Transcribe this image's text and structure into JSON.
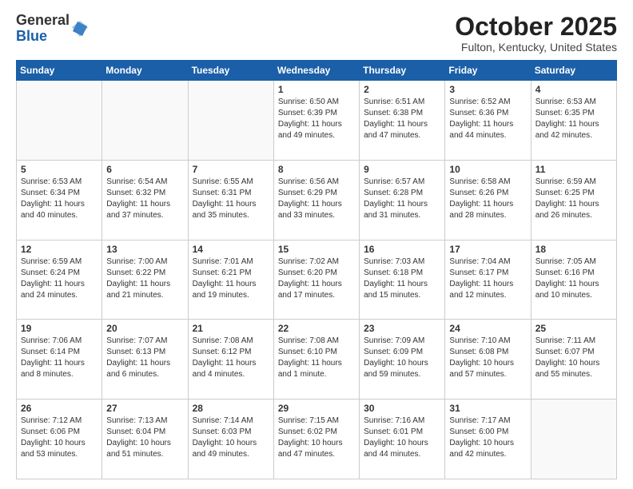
{
  "logo": {
    "general": "General",
    "blue": "Blue"
  },
  "header": {
    "month": "October 2025",
    "location": "Fulton, Kentucky, United States"
  },
  "weekdays": [
    "Sunday",
    "Monday",
    "Tuesday",
    "Wednesday",
    "Thursday",
    "Friday",
    "Saturday"
  ],
  "weeks": [
    [
      {
        "day": "",
        "info": ""
      },
      {
        "day": "",
        "info": ""
      },
      {
        "day": "",
        "info": ""
      },
      {
        "day": "1",
        "info": "Sunrise: 6:50 AM\nSunset: 6:39 PM\nDaylight: 11 hours\nand 49 minutes."
      },
      {
        "day": "2",
        "info": "Sunrise: 6:51 AM\nSunset: 6:38 PM\nDaylight: 11 hours\nand 47 minutes."
      },
      {
        "day": "3",
        "info": "Sunrise: 6:52 AM\nSunset: 6:36 PM\nDaylight: 11 hours\nand 44 minutes."
      },
      {
        "day": "4",
        "info": "Sunrise: 6:53 AM\nSunset: 6:35 PM\nDaylight: 11 hours\nand 42 minutes."
      }
    ],
    [
      {
        "day": "5",
        "info": "Sunrise: 6:53 AM\nSunset: 6:34 PM\nDaylight: 11 hours\nand 40 minutes."
      },
      {
        "day": "6",
        "info": "Sunrise: 6:54 AM\nSunset: 6:32 PM\nDaylight: 11 hours\nand 37 minutes."
      },
      {
        "day": "7",
        "info": "Sunrise: 6:55 AM\nSunset: 6:31 PM\nDaylight: 11 hours\nand 35 minutes."
      },
      {
        "day": "8",
        "info": "Sunrise: 6:56 AM\nSunset: 6:29 PM\nDaylight: 11 hours\nand 33 minutes."
      },
      {
        "day": "9",
        "info": "Sunrise: 6:57 AM\nSunset: 6:28 PM\nDaylight: 11 hours\nand 31 minutes."
      },
      {
        "day": "10",
        "info": "Sunrise: 6:58 AM\nSunset: 6:26 PM\nDaylight: 11 hours\nand 28 minutes."
      },
      {
        "day": "11",
        "info": "Sunrise: 6:59 AM\nSunset: 6:25 PM\nDaylight: 11 hours\nand 26 minutes."
      }
    ],
    [
      {
        "day": "12",
        "info": "Sunrise: 6:59 AM\nSunset: 6:24 PM\nDaylight: 11 hours\nand 24 minutes."
      },
      {
        "day": "13",
        "info": "Sunrise: 7:00 AM\nSunset: 6:22 PM\nDaylight: 11 hours\nand 21 minutes."
      },
      {
        "day": "14",
        "info": "Sunrise: 7:01 AM\nSunset: 6:21 PM\nDaylight: 11 hours\nand 19 minutes."
      },
      {
        "day": "15",
        "info": "Sunrise: 7:02 AM\nSunset: 6:20 PM\nDaylight: 11 hours\nand 17 minutes."
      },
      {
        "day": "16",
        "info": "Sunrise: 7:03 AM\nSunset: 6:18 PM\nDaylight: 11 hours\nand 15 minutes."
      },
      {
        "day": "17",
        "info": "Sunrise: 7:04 AM\nSunset: 6:17 PM\nDaylight: 11 hours\nand 12 minutes."
      },
      {
        "day": "18",
        "info": "Sunrise: 7:05 AM\nSunset: 6:16 PM\nDaylight: 11 hours\nand 10 minutes."
      }
    ],
    [
      {
        "day": "19",
        "info": "Sunrise: 7:06 AM\nSunset: 6:14 PM\nDaylight: 11 hours\nand 8 minutes."
      },
      {
        "day": "20",
        "info": "Sunrise: 7:07 AM\nSunset: 6:13 PM\nDaylight: 11 hours\nand 6 minutes."
      },
      {
        "day": "21",
        "info": "Sunrise: 7:08 AM\nSunset: 6:12 PM\nDaylight: 11 hours\nand 4 minutes."
      },
      {
        "day": "22",
        "info": "Sunrise: 7:08 AM\nSunset: 6:10 PM\nDaylight: 11 hours\nand 1 minute."
      },
      {
        "day": "23",
        "info": "Sunrise: 7:09 AM\nSunset: 6:09 PM\nDaylight: 10 hours\nand 59 minutes."
      },
      {
        "day": "24",
        "info": "Sunrise: 7:10 AM\nSunset: 6:08 PM\nDaylight: 10 hours\nand 57 minutes."
      },
      {
        "day": "25",
        "info": "Sunrise: 7:11 AM\nSunset: 6:07 PM\nDaylight: 10 hours\nand 55 minutes."
      }
    ],
    [
      {
        "day": "26",
        "info": "Sunrise: 7:12 AM\nSunset: 6:06 PM\nDaylight: 10 hours\nand 53 minutes."
      },
      {
        "day": "27",
        "info": "Sunrise: 7:13 AM\nSunset: 6:04 PM\nDaylight: 10 hours\nand 51 minutes."
      },
      {
        "day": "28",
        "info": "Sunrise: 7:14 AM\nSunset: 6:03 PM\nDaylight: 10 hours\nand 49 minutes."
      },
      {
        "day": "29",
        "info": "Sunrise: 7:15 AM\nSunset: 6:02 PM\nDaylight: 10 hours\nand 47 minutes."
      },
      {
        "day": "30",
        "info": "Sunrise: 7:16 AM\nSunset: 6:01 PM\nDaylight: 10 hours\nand 44 minutes."
      },
      {
        "day": "31",
        "info": "Sunrise: 7:17 AM\nSunset: 6:00 PM\nDaylight: 10 hours\nand 42 minutes."
      },
      {
        "day": "",
        "info": ""
      }
    ]
  ]
}
